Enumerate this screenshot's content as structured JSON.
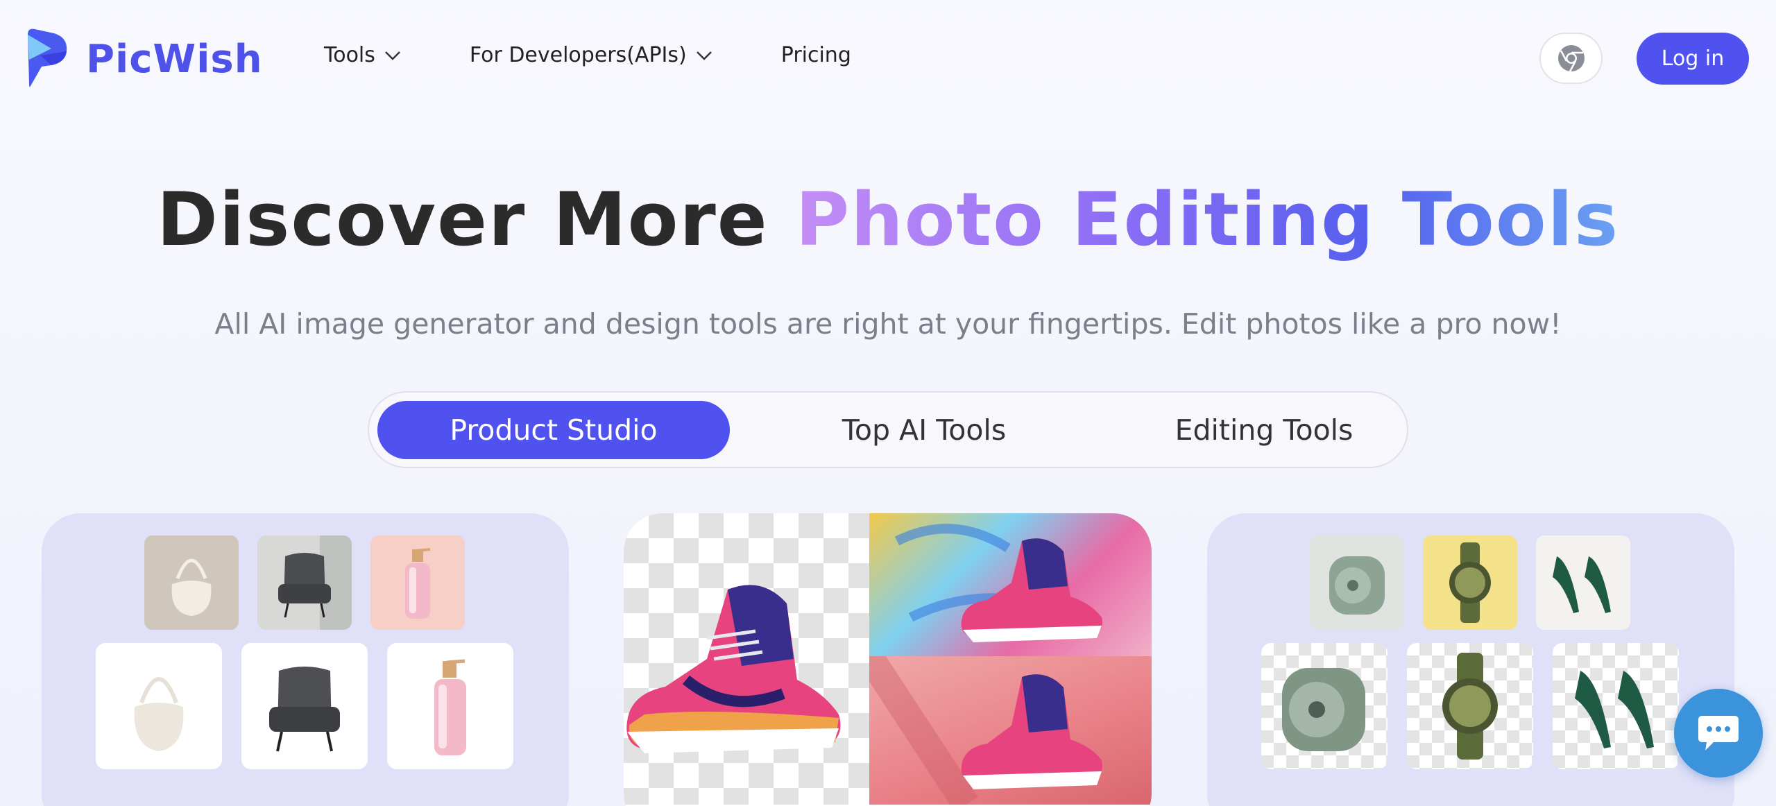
{
  "brand": {
    "name": "PicWish",
    "color": "#4f52e8"
  },
  "nav": {
    "tools_label": "Tools",
    "developers_label": "For Developers(APIs)",
    "pricing_label": "Pricing"
  },
  "header": {
    "login_label": "Log in",
    "extension_icon": "chrome-icon"
  },
  "hero": {
    "title_plain": "Discover More ",
    "title_highlight": "Photo Editing Tools",
    "subtitle": "All AI image generator and design tools are right at your fingertips. Edit photos like a pro now!"
  },
  "tabs": [
    {
      "label": "Product Studio",
      "active": true
    },
    {
      "label": "Top AI Tools",
      "active": false
    },
    {
      "label": "Editing Tools",
      "active": false
    }
  ],
  "cards": {
    "left": {
      "examples_top": [
        "handbag",
        "armchair",
        "pump-bottle"
      ],
      "results_bottom": [
        "handbag-white-bg",
        "armchair-white-bg",
        "pump-bottle-white-bg"
      ]
    },
    "middle": {
      "original": "sneaker-transparent",
      "variants": [
        "sneaker-graffiti-bg",
        "sneaker-pink-bg"
      ]
    },
    "right": {
      "examples_top": [
        "speaker",
        "watch",
        "heels"
      ],
      "results_bottom": [
        "speaker-transparent",
        "watch-transparent",
        "heels-transparent"
      ]
    }
  },
  "colors": {
    "accent": "#4f52ee",
    "card_bg": "#e0e0f8",
    "chat": "#3a93db"
  },
  "chat": {
    "icon": "chat-bubble-icon"
  }
}
